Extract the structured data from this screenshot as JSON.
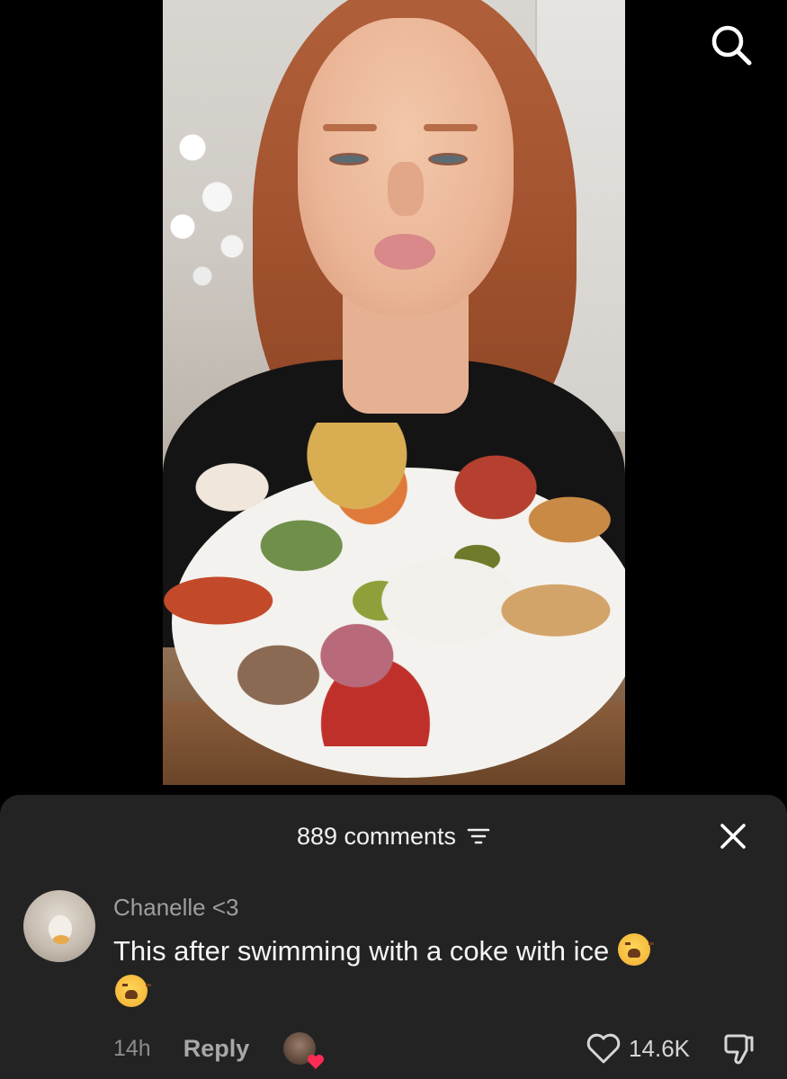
{
  "comments_panel": {
    "count_label": "889 comments",
    "comment": {
      "username": "Chanelle <3",
      "text": "This after swimming with a coke with ice",
      "emoji": "😩",
      "time": "14h",
      "reply_label": "Reply",
      "like_count": "14.6K"
    }
  },
  "icons": {
    "search": "search-icon",
    "filter": "filter-icon",
    "close": "close-icon",
    "like": "heart-icon",
    "dislike": "dislike-icon",
    "creator_liked": "creator-liked-heart-icon"
  },
  "colors": {
    "panel_background": "#232323",
    "creator_heart": "#fe2c55"
  }
}
